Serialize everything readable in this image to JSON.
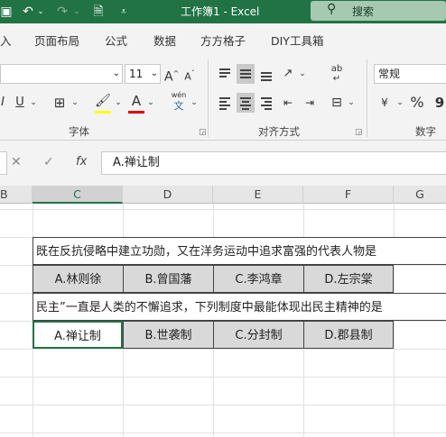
{
  "titlebar": {
    "title": "工作簿1  -  Excel",
    "search_label": "搜索",
    "icons": [
      "save-icon",
      "undo-icon",
      "undo-dropdown-icon",
      "redo-icon",
      "redo-dropdown-icon",
      "print-preview-icon",
      "customize-qat-icon"
    ]
  },
  "tabs": [
    "入",
    "页面布局",
    "公式",
    "数据",
    "方方格子",
    "DIY工具箱"
  ],
  "ribbon": {
    "font_size": "11",
    "font_group_label": "字体",
    "align_group_label": "对齐方式",
    "number_group_label": "数字",
    "number_format": "常规",
    "bold": "I",
    "underline": "U",
    "wen": "wén",
    "wen_char": "文",
    "grow_font": "A",
    "shrink_font": "A",
    "font_color_letter": "A",
    "percent": "%",
    "comma": "9",
    "abc": "ab",
    "currency": "¥",
    "colors": {
      "fill": "#ffff00",
      "font": "#e00000",
      "accent": "#217346"
    }
  },
  "formula_bar": {
    "cancel": "✕",
    "confirm": "✓",
    "fx": "fx",
    "value": "A.禅让制"
  },
  "columns": [
    "B",
    "C",
    "D",
    "E",
    "F",
    "G"
  ],
  "rows": {
    "q1": {
      "text": "既在反抗侵略中建立功勋，又在洋务运动中追求富强的代表人物是",
      "options": [
        "A.林则徐",
        "B.曾国藩",
        "C.李鸿章",
        "D.左宗棠"
      ]
    },
    "q2": {
      "text": "民主”一直是人类的不懈追求，下列制度中最能体现出民主精神的是",
      "options": [
        "A.禅让制",
        "B.世袭制",
        "C.分封制",
        "D.郡县制"
      ]
    }
  }
}
